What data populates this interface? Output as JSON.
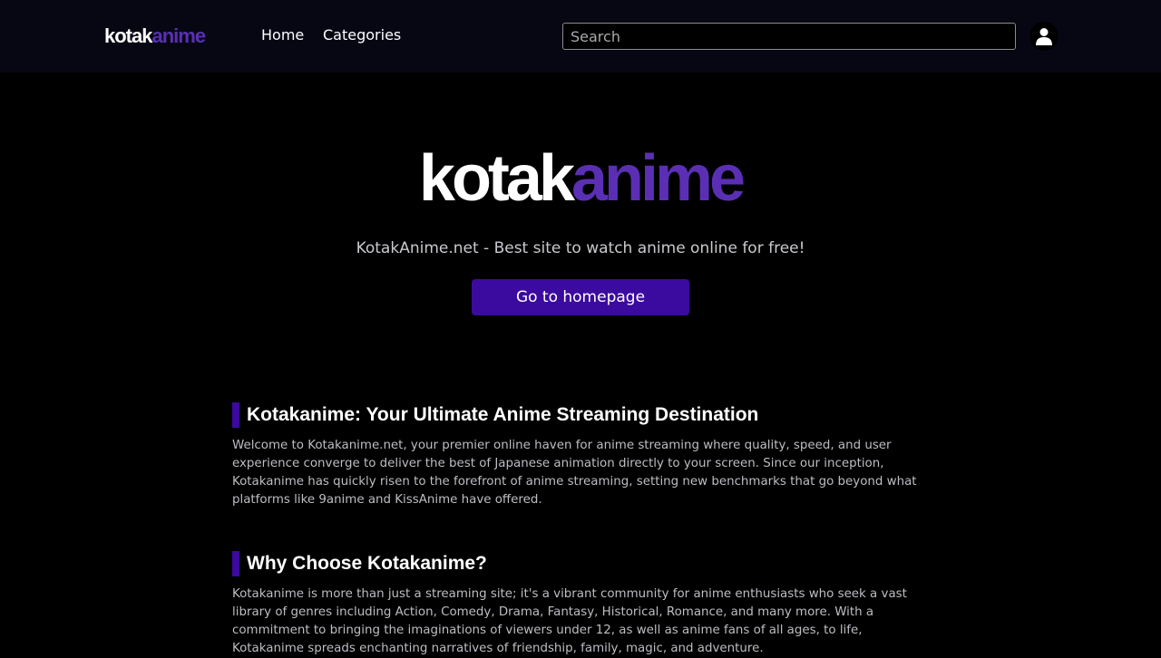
{
  "header": {
    "logo": {
      "part1": "kotak",
      "part2": "anime"
    },
    "nav": {
      "home": "Home",
      "categories": "Categories"
    },
    "search": {
      "placeholder": "Search",
      "value": ""
    },
    "user_icon": "user-icon"
  },
  "hero": {
    "logo": {
      "part1": "kotak",
      "part2": "anime"
    },
    "tagline": "KotakAnime.net - Best site to watch anime online for free!",
    "button_label": "Go to homepage"
  },
  "sections": [
    {
      "title": "Kotakanime: Your Ultimate Anime Streaming Destination",
      "body": "Welcome to Kotakanime.net, your premier online haven for anime streaming where quality, speed, and user experience converge to deliver the best of Japanese animation directly to your screen. Since our inception, Kotakanime has quickly risen to the forefront of anime streaming, setting new benchmarks that go beyond what platforms like 9anime and KissAnime have offered."
    },
    {
      "title": "Why Choose Kotakanime?",
      "body": "Kotakanime is more than just a streaming site; it's a vibrant community for anime enthusiasts who seek a vast library of genres including Action, Comedy, Drama, Fantasy, Historical, Romance, and many more. With a commitment to bringing the imaginations of viewers under 12, as well as anime fans of all ages, to life, Kotakanime spreads enchanting narratives of friendship, family, magic, and adventure."
    }
  ],
  "colors": {
    "accent": "#3b0a9e",
    "logo_purple": "#5a2fb4",
    "navbar_bg": "#070714",
    "page_bg": "#000000"
  }
}
